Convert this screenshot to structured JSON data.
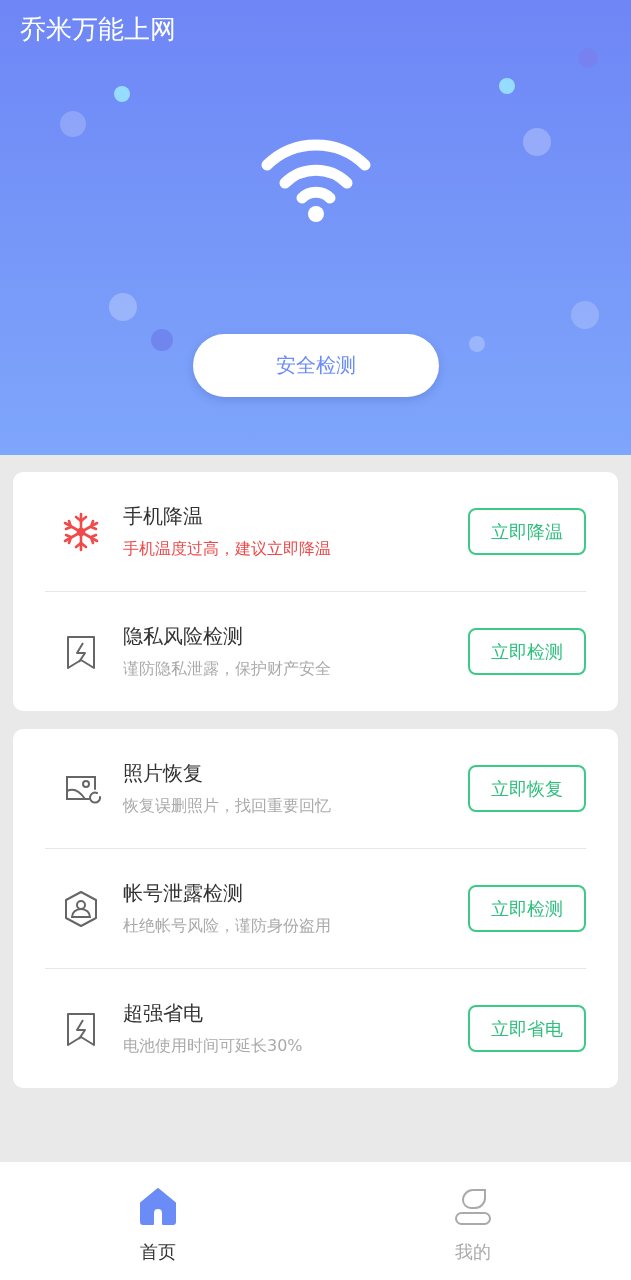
{
  "app_title": "乔米万能上网",
  "scan_button": "安全检测",
  "groups": [
    {
      "items": [
        {
          "kind": "cooling",
          "title": "手机降温",
          "subtitle": "手机温度过高，建议立即降温",
          "alert": true,
          "action": "立即降温"
        },
        {
          "kind": "privacy",
          "title": "隐私风险检测",
          "subtitle": "谨防隐私泄露，保护财产安全",
          "alert": false,
          "action": "立即检测"
        }
      ]
    },
    {
      "items": [
        {
          "kind": "photo",
          "title": "照片恢复",
          "subtitle": "恢复误删照片，找回重要回忆",
          "alert": false,
          "action": "立即恢复"
        },
        {
          "kind": "account",
          "title": "帐号泄露检测",
          "subtitle": "杜绝帐号风险，谨防身份盗用",
          "alert": false,
          "action": "立即检测"
        },
        {
          "kind": "battery",
          "title": "超强省电",
          "subtitle": "电池使用时间可延长30%",
          "alert": false,
          "action": "立即省电"
        }
      ]
    }
  ],
  "tabs": [
    {
      "kind": "home",
      "label": "首页",
      "selected": true
    },
    {
      "kind": "me",
      "label": "我的",
      "selected": false
    }
  ]
}
